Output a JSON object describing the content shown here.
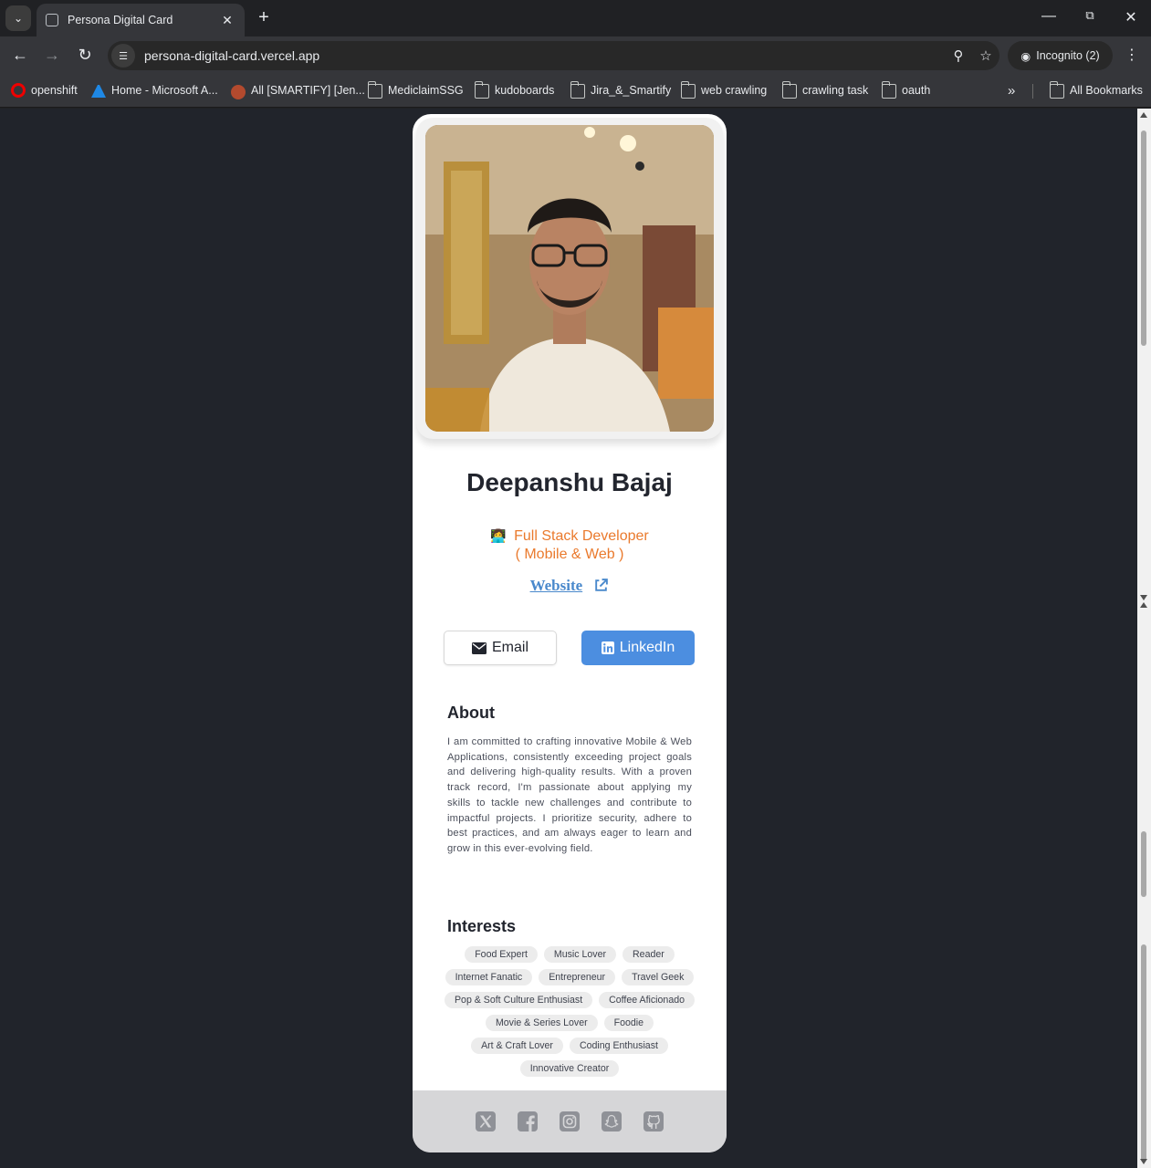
{
  "browser": {
    "tab_title": "Persona Digital Card",
    "url": "persona-digital-card.vercel.app",
    "incognito_label": "Incognito (2)",
    "new_tab_label": "+",
    "bookmarks": [
      {
        "label": "openshift",
        "icon": "openshift-icon"
      },
      {
        "label": "Home - Microsoft A...",
        "icon": "azure-icon"
      },
      {
        "label": "All [SMARTIFY] [Jen...",
        "icon": "jenkins-icon"
      },
      {
        "label": "MediclaimSSG",
        "icon": "folder-icon"
      },
      {
        "label": "kudoboards",
        "icon": "folder-icon"
      },
      {
        "label": "Jira_&_Smartify",
        "icon": "folder-icon"
      },
      {
        "label": "web crawling",
        "icon": "folder-icon"
      },
      {
        "label": "crawling task",
        "icon": "folder-icon"
      },
      {
        "label": "oauth",
        "icon": "folder-icon"
      }
    ],
    "more_bookmarks": "»",
    "all_bookmarks": "All Bookmarks"
  },
  "profile": {
    "name": "Deepanshu Bajaj",
    "role_line1": "Full Stack Developer",
    "role_line2": "( Mobile & Web )",
    "role_icon": "developer-emoji",
    "website_label": "Website",
    "email_label": "Email",
    "linkedin_label": "LinkedIn",
    "accent_color": "#ea7a2d",
    "link_color": "#4a89cc",
    "linkedin_color": "#4c8ee0"
  },
  "about": {
    "title": "About",
    "text": "I am committed to crafting innovative Mobile & Web Applications, consistently exceeding project goals and delivering high-quality results. With a proven track record, I'm passionate about applying my skills to tackle new challenges and contribute to impactful projects. I prioritize security, adhere to best practices, and am always eager to learn and grow in this ever-evolving field."
  },
  "interests": {
    "title": "Interests",
    "items": [
      "Food Expert",
      "Music Lover",
      "Reader",
      "Internet Fanatic",
      "Entrepreneur",
      "Travel Geek",
      "Pop & Soft Culture Enthusiast",
      "Coffee Aficionado",
      "Movie & Series Lover",
      "Foodie",
      "Art & Craft Lover",
      "Coding Enthusiast",
      "Innovative Creator"
    ]
  },
  "footer": {
    "icons": [
      "x-twitter-icon",
      "facebook-icon",
      "instagram-icon",
      "snapchat-icon",
      "github-icon"
    ]
  }
}
